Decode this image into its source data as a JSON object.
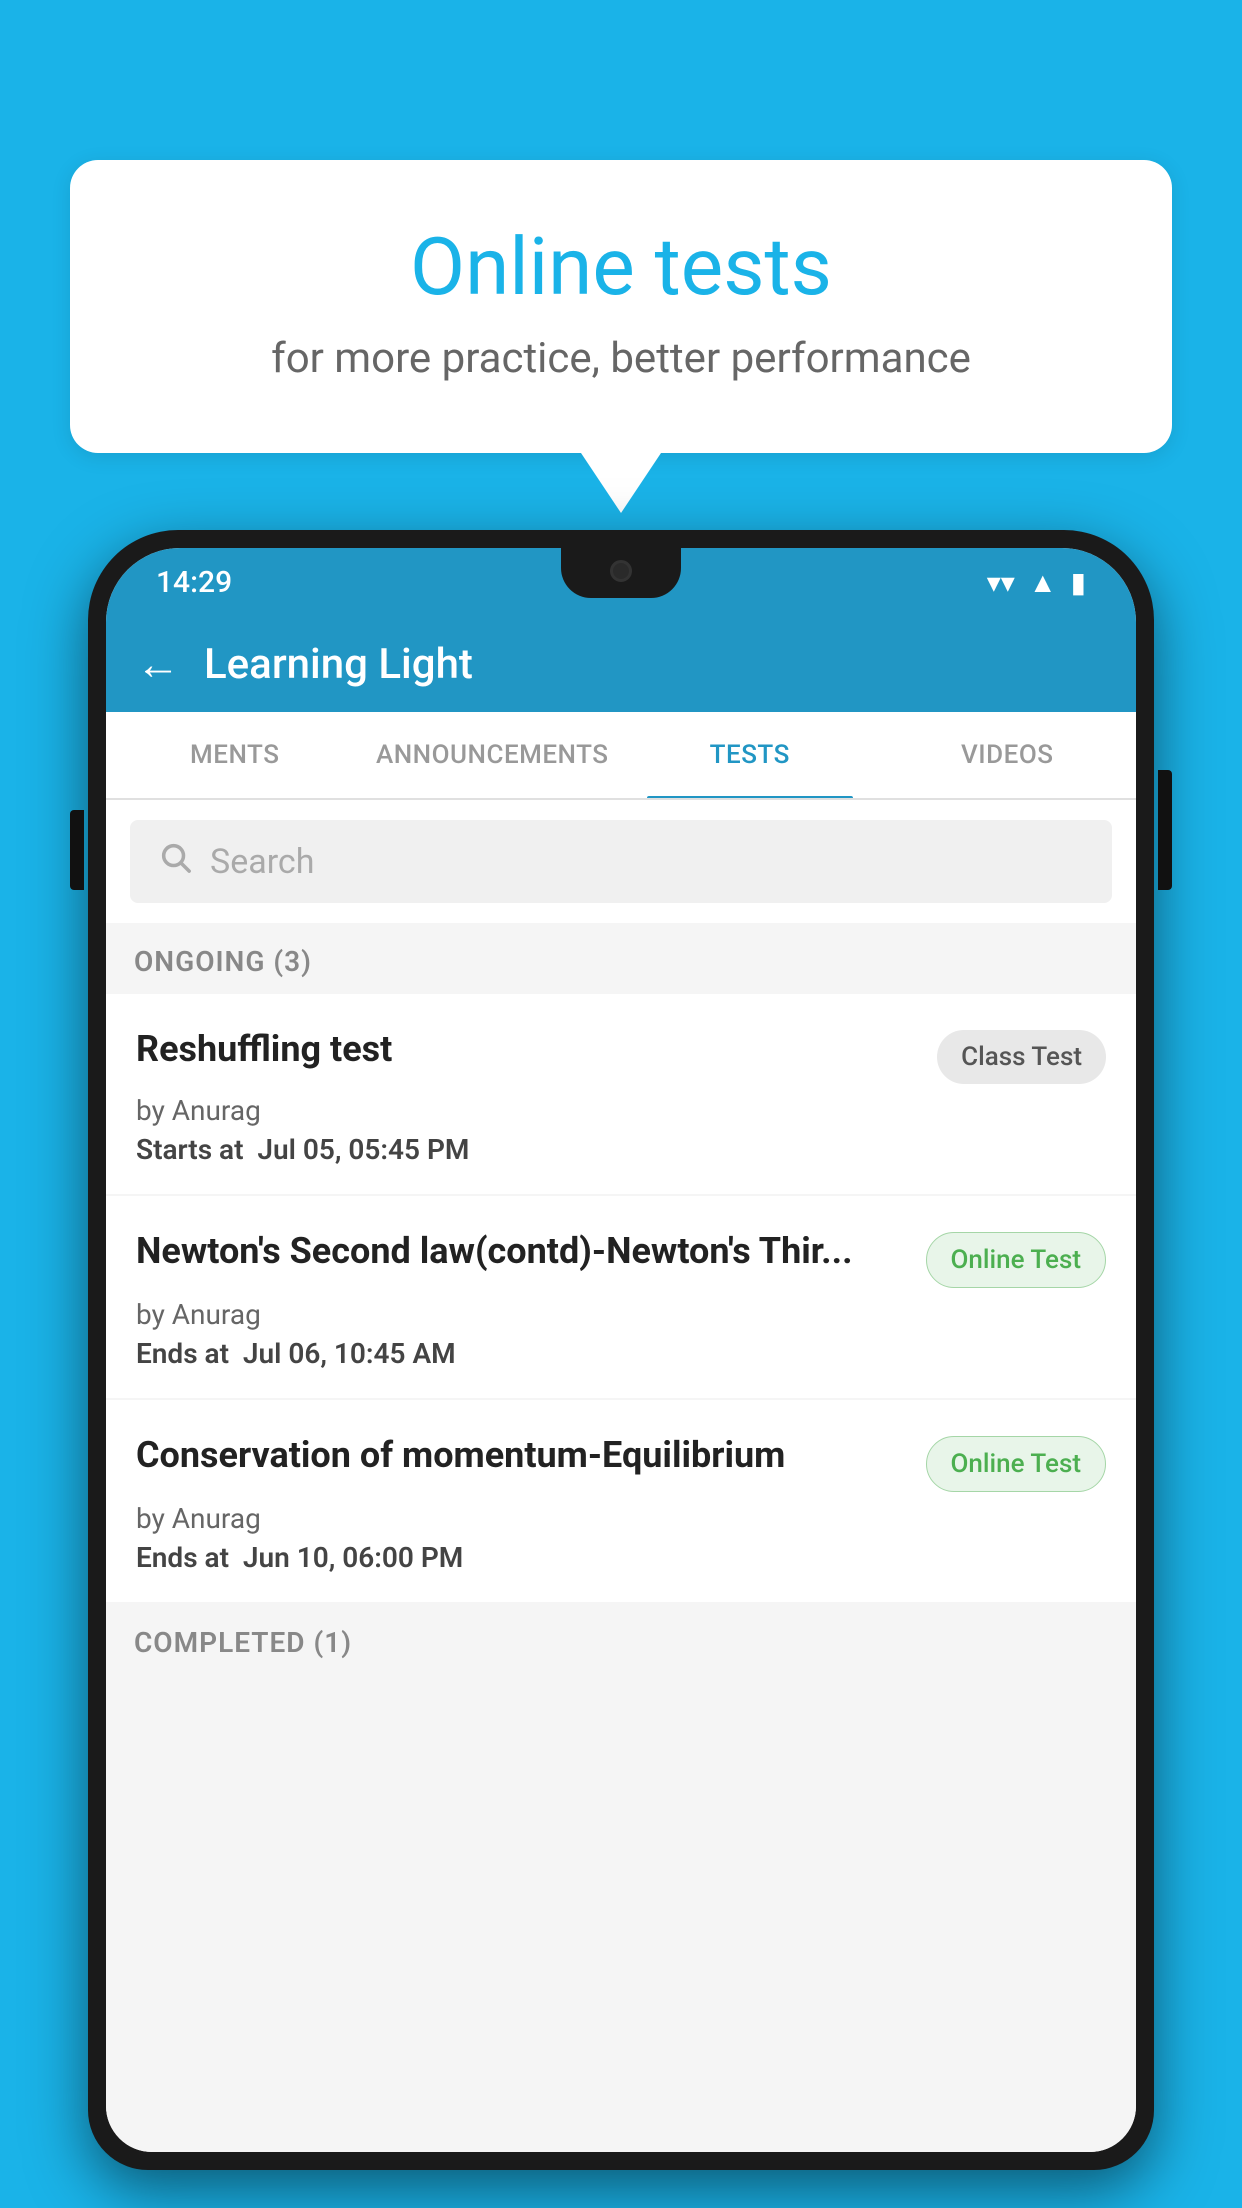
{
  "background_color": "#1ab3e8",
  "speech_bubble": {
    "title": "Online tests",
    "subtitle": "for more practice, better performance"
  },
  "status_bar": {
    "time": "14:29",
    "wifi_icon": "▼",
    "signal_icon": "▲",
    "battery_icon": "▮"
  },
  "app_bar": {
    "back_icon": "←",
    "title": "Learning Light"
  },
  "tabs": [
    {
      "label": "MENTS",
      "active": false
    },
    {
      "label": "ANNOUNCEMENTS",
      "active": false
    },
    {
      "label": "TESTS",
      "active": true
    },
    {
      "label": "VIDEOS",
      "active": false
    }
  ],
  "search": {
    "placeholder": "Search",
    "icon": "🔍"
  },
  "ongoing_section": {
    "label": "ONGOING (3)",
    "tests": [
      {
        "title": "Reshuffling test",
        "by": "by Anurag",
        "date_label": "Starts at",
        "date_value": "Jul 05, 05:45 PM",
        "badge": "Class Test",
        "badge_type": "class"
      },
      {
        "title": "Newton's Second law(contd)-Newton's Thir...",
        "by": "by Anurag",
        "date_label": "Ends at",
        "date_value": "Jul 06, 10:45 AM",
        "badge": "Online Test",
        "badge_type": "online"
      },
      {
        "title": "Conservation of momentum-Equilibrium",
        "by": "by Anurag",
        "date_label": "Ends at",
        "date_value": "Jun 10, 06:00 PM",
        "badge": "Online Test",
        "badge_type": "online"
      }
    ]
  },
  "completed_section": {
    "label": "COMPLETED (1)"
  }
}
